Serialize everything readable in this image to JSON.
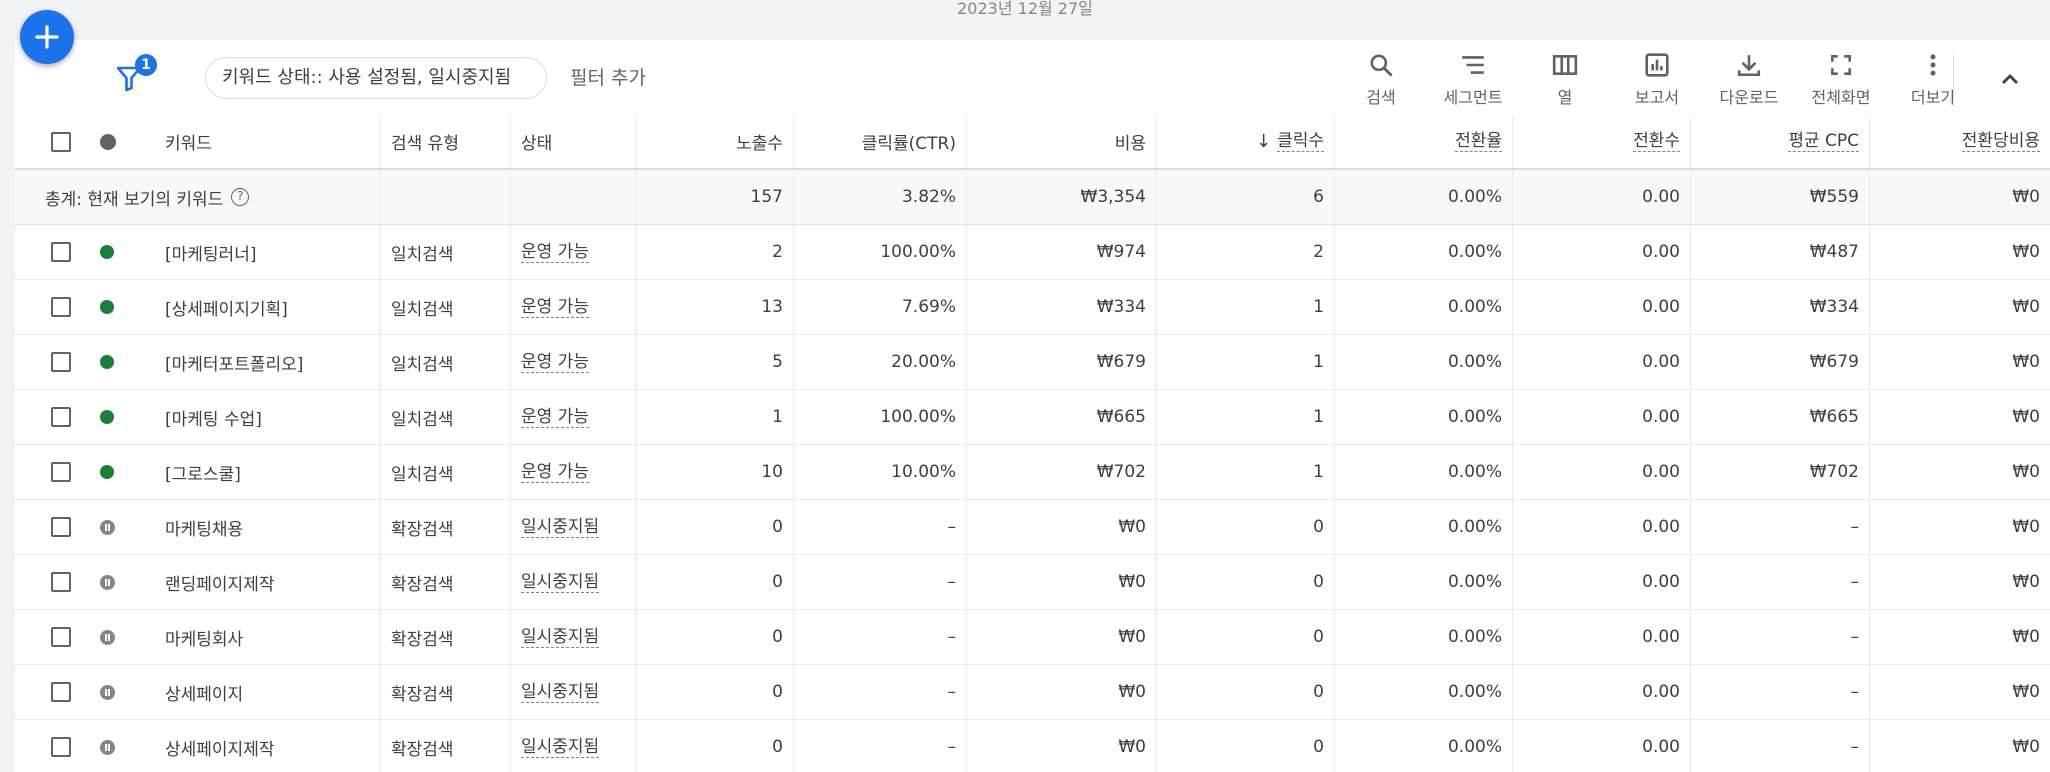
{
  "date_label": "2023년 12월 27일",
  "fab": {
    "icon": "plus-icon"
  },
  "filter": {
    "badge": "1",
    "chip_text": "키워드 상태:: 사용 설정됨, 일시중지됨",
    "add_label": "필터 추가"
  },
  "tools": [
    {
      "id": "search",
      "label": "검색",
      "icon": "search-icon"
    },
    {
      "id": "segment",
      "label": "세그먼트",
      "icon": "segment-icon"
    },
    {
      "id": "columns",
      "label": "열",
      "icon": "columns-icon"
    },
    {
      "id": "report",
      "label": "보고서",
      "icon": "report-icon"
    },
    {
      "id": "download",
      "label": "다운로드",
      "icon": "download-icon"
    },
    {
      "id": "fullscreen",
      "label": "전체화면",
      "icon": "fullscreen-icon"
    },
    {
      "id": "more",
      "label": "더보기",
      "icon": "more-vert-icon"
    }
  ],
  "columns": {
    "keyword": "키워드",
    "match_type": "검색 유형",
    "status": "상태",
    "impressions": "노출수",
    "ctr": "클릭률(CTR)",
    "cost": "비용",
    "clicks": "클릭수",
    "conv_rate": "전환율",
    "conversions": "전환수",
    "avg_cpc": "평균 CPC",
    "cost_per_conv": "전환당비용"
  },
  "sort_indicator": "↓",
  "total": {
    "label": "총계: 현재 보기의 키워드",
    "impressions": "157",
    "ctr": "3.82%",
    "cost": "₩3,354",
    "clicks": "6",
    "conv_rate": "0.00%",
    "conversions": "0.00",
    "avg_cpc": "₩559",
    "cost_per_conv": "₩0"
  },
  "rows": [
    {
      "state": "enabled",
      "keyword": "[마케팅러너]",
      "match_type": "일치검색",
      "status": "운영 가능",
      "impressions": "2",
      "ctr": "100.00%",
      "cost": "₩974",
      "clicks": "2",
      "conv_rate": "0.00%",
      "conversions": "0.00",
      "avg_cpc": "₩487",
      "cost_per_conv": "₩0"
    },
    {
      "state": "enabled",
      "keyword": "[상세페이지기획]",
      "match_type": "일치검색",
      "status": "운영 가능",
      "impressions": "13",
      "ctr": "7.69%",
      "cost": "₩334",
      "clicks": "1",
      "conv_rate": "0.00%",
      "conversions": "0.00",
      "avg_cpc": "₩334",
      "cost_per_conv": "₩0"
    },
    {
      "state": "enabled",
      "keyword": "[마케터포트폴리오]",
      "match_type": "일치검색",
      "status": "운영 가능",
      "impressions": "5",
      "ctr": "20.00%",
      "cost": "₩679",
      "clicks": "1",
      "conv_rate": "0.00%",
      "conversions": "0.00",
      "avg_cpc": "₩679",
      "cost_per_conv": "₩0"
    },
    {
      "state": "enabled",
      "keyword": "[마케팅 수업]",
      "match_type": "일치검색",
      "status": "운영 가능",
      "impressions": "1",
      "ctr": "100.00%",
      "cost": "₩665",
      "clicks": "1",
      "conv_rate": "0.00%",
      "conversions": "0.00",
      "avg_cpc": "₩665",
      "cost_per_conv": "₩0"
    },
    {
      "state": "enabled",
      "keyword": "[그로스쿨]",
      "match_type": "일치검색",
      "status": "운영 가능",
      "impressions": "10",
      "ctr": "10.00%",
      "cost": "₩702",
      "clicks": "1",
      "conv_rate": "0.00%",
      "conversions": "0.00",
      "avg_cpc": "₩702",
      "cost_per_conv": "₩0"
    },
    {
      "state": "paused",
      "keyword": "마케팅채용",
      "match_type": "확장검색",
      "status": "일시중지됨",
      "impressions": "0",
      "ctr": "–",
      "cost": "₩0",
      "clicks": "0",
      "conv_rate": "0.00%",
      "conversions": "0.00",
      "avg_cpc": "–",
      "cost_per_conv": "₩0"
    },
    {
      "state": "paused",
      "keyword": "랜딩페이지제작",
      "match_type": "확장검색",
      "status": "일시중지됨",
      "impressions": "0",
      "ctr": "–",
      "cost": "₩0",
      "clicks": "0",
      "conv_rate": "0.00%",
      "conversions": "0.00",
      "avg_cpc": "–",
      "cost_per_conv": "₩0"
    },
    {
      "state": "paused",
      "keyword": "마케팅회사",
      "match_type": "확장검색",
      "status": "일시중지됨",
      "impressions": "0",
      "ctr": "–",
      "cost": "₩0",
      "clicks": "0",
      "conv_rate": "0.00%",
      "conversions": "0.00",
      "avg_cpc": "–",
      "cost_per_conv": "₩0"
    },
    {
      "state": "paused",
      "keyword": "상세페이지",
      "match_type": "확장검색",
      "status": "일시중지됨",
      "impressions": "0",
      "ctr": "–",
      "cost": "₩0",
      "clicks": "0",
      "conv_rate": "0.00%",
      "conversions": "0.00",
      "avg_cpc": "–",
      "cost_per_conv": "₩0"
    },
    {
      "state": "paused",
      "keyword": "상세페이지제작",
      "match_type": "확장검색",
      "status": "일시중지됨",
      "impressions": "0",
      "ctr": "–",
      "cost": "₩0",
      "clicks": "0",
      "conv_rate": "0.00%",
      "conversions": "0.00",
      "avg_cpc": "–",
      "cost_per_conv": "₩0"
    }
  ]
}
